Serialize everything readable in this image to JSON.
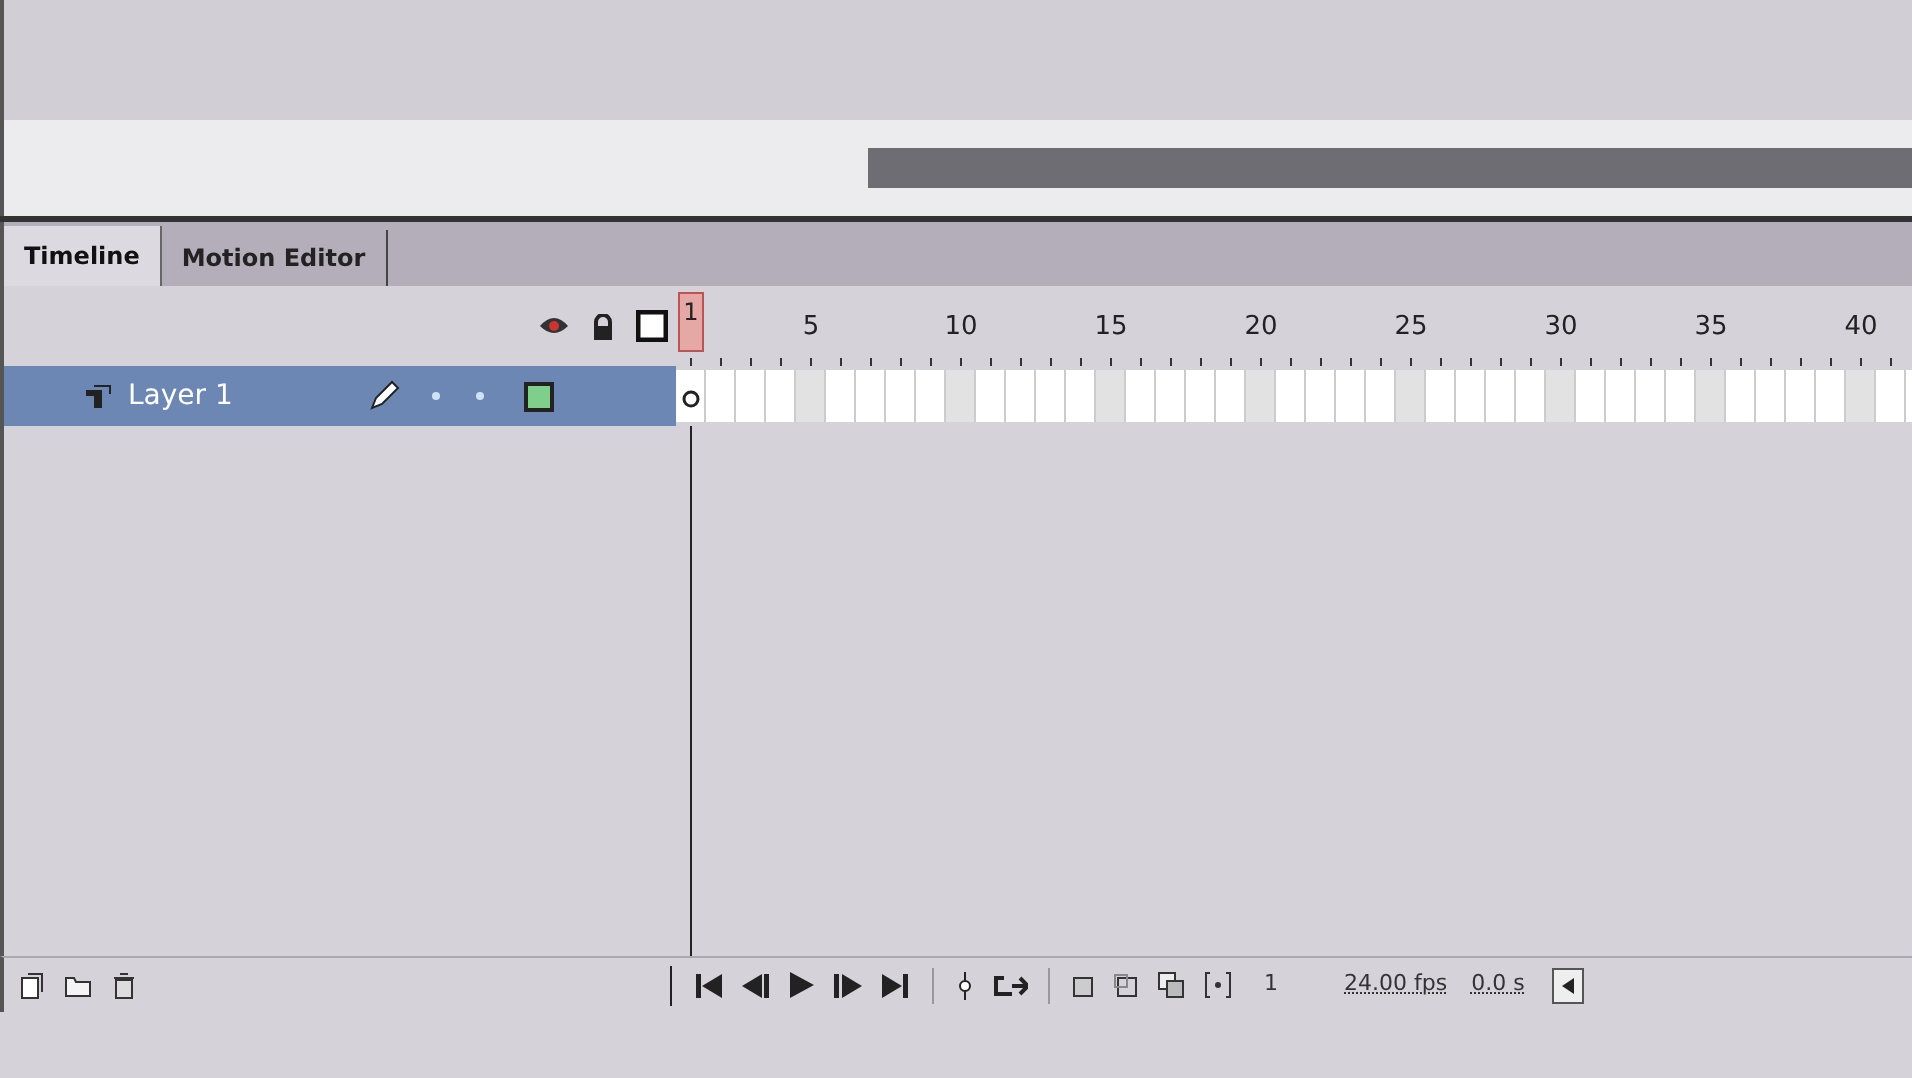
{
  "tabs": [
    {
      "label": "Timeline",
      "selected": true
    },
    {
      "label": "Motion Editor",
      "selected": false
    }
  ],
  "ruler": {
    "marks": [
      "1",
      "5",
      "10",
      "15",
      "20",
      "25",
      "30",
      "35",
      "40"
    ]
  },
  "layers": [
    {
      "name": "Layer 1",
      "selected": true
    }
  ],
  "status": {
    "frame": "1",
    "fps": "24.00 fps",
    "time": "0.0 s"
  }
}
